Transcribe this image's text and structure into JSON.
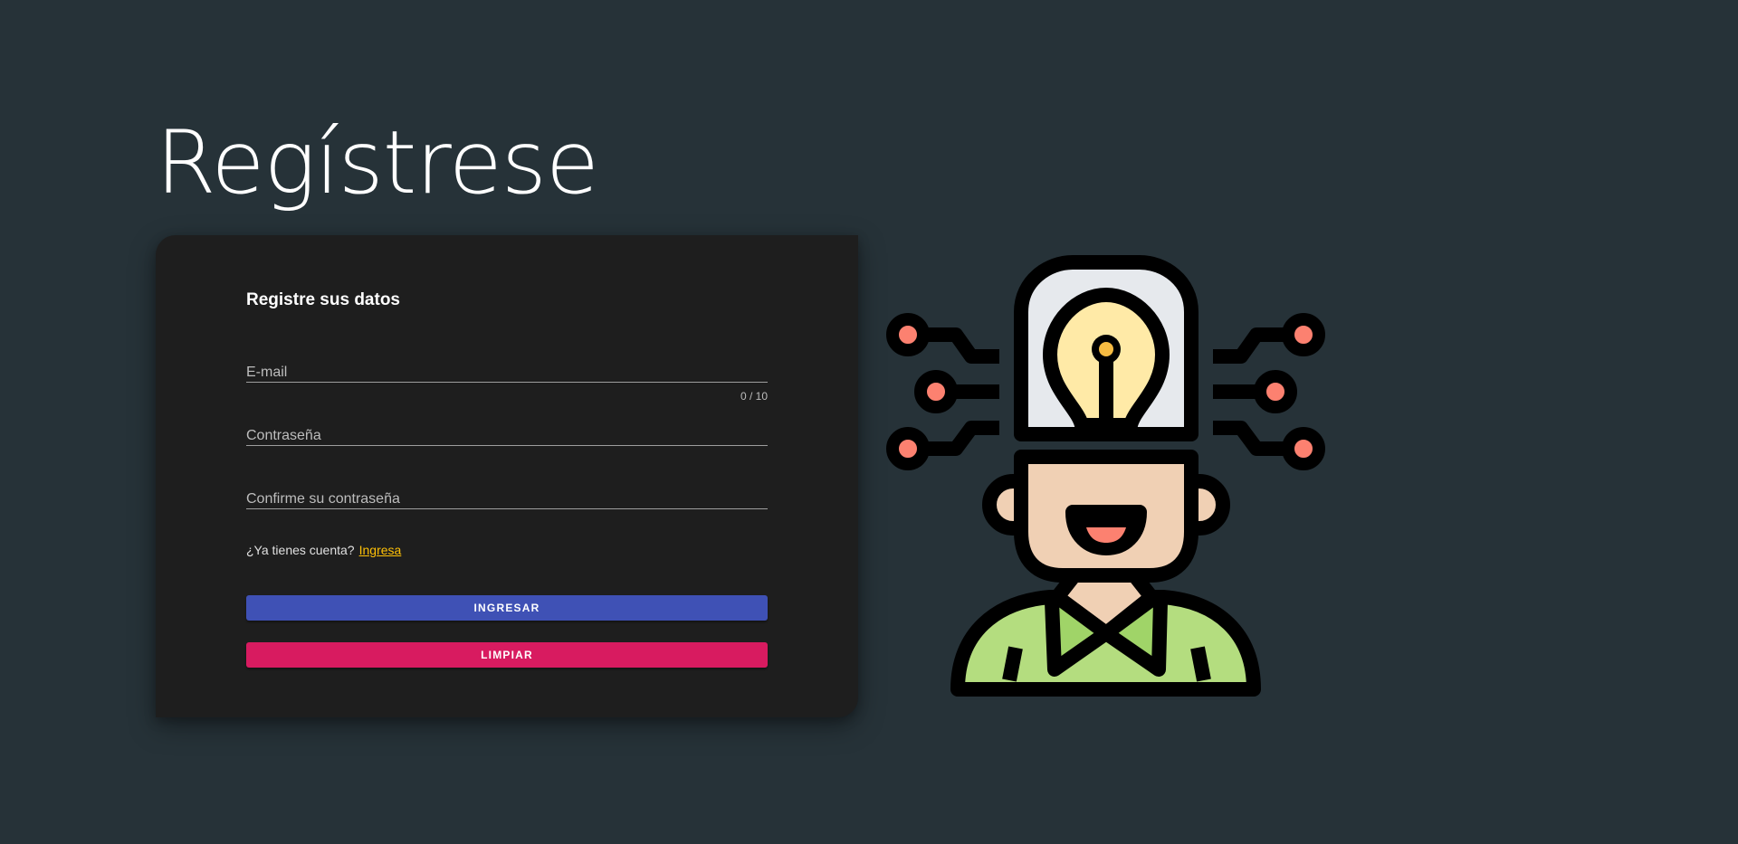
{
  "page": {
    "title": "Regístrese"
  },
  "form": {
    "heading": "Registre sus datos",
    "email_placeholder": "E-mail",
    "email_value": "",
    "email_counter": "0 / 10",
    "password_placeholder": "Contraseña",
    "password_value": "",
    "confirm_placeholder": "Confirme su contraseña",
    "confirm_value": "",
    "account_prompt": "¿Ya tienes cuenta?",
    "login_link": "Ingresa",
    "submit_label": "INGRESAR",
    "clear_label": "LIMPIAR"
  },
  "colors": {
    "background": "#263238",
    "card": "#1e1e1e",
    "primary": "#3f51b5",
    "danger": "#d81b60",
    "link": "#ffc107"
  },
  "illustration": {
    "icon": "person-with-idea-lightbulb-icon"
  }
}
